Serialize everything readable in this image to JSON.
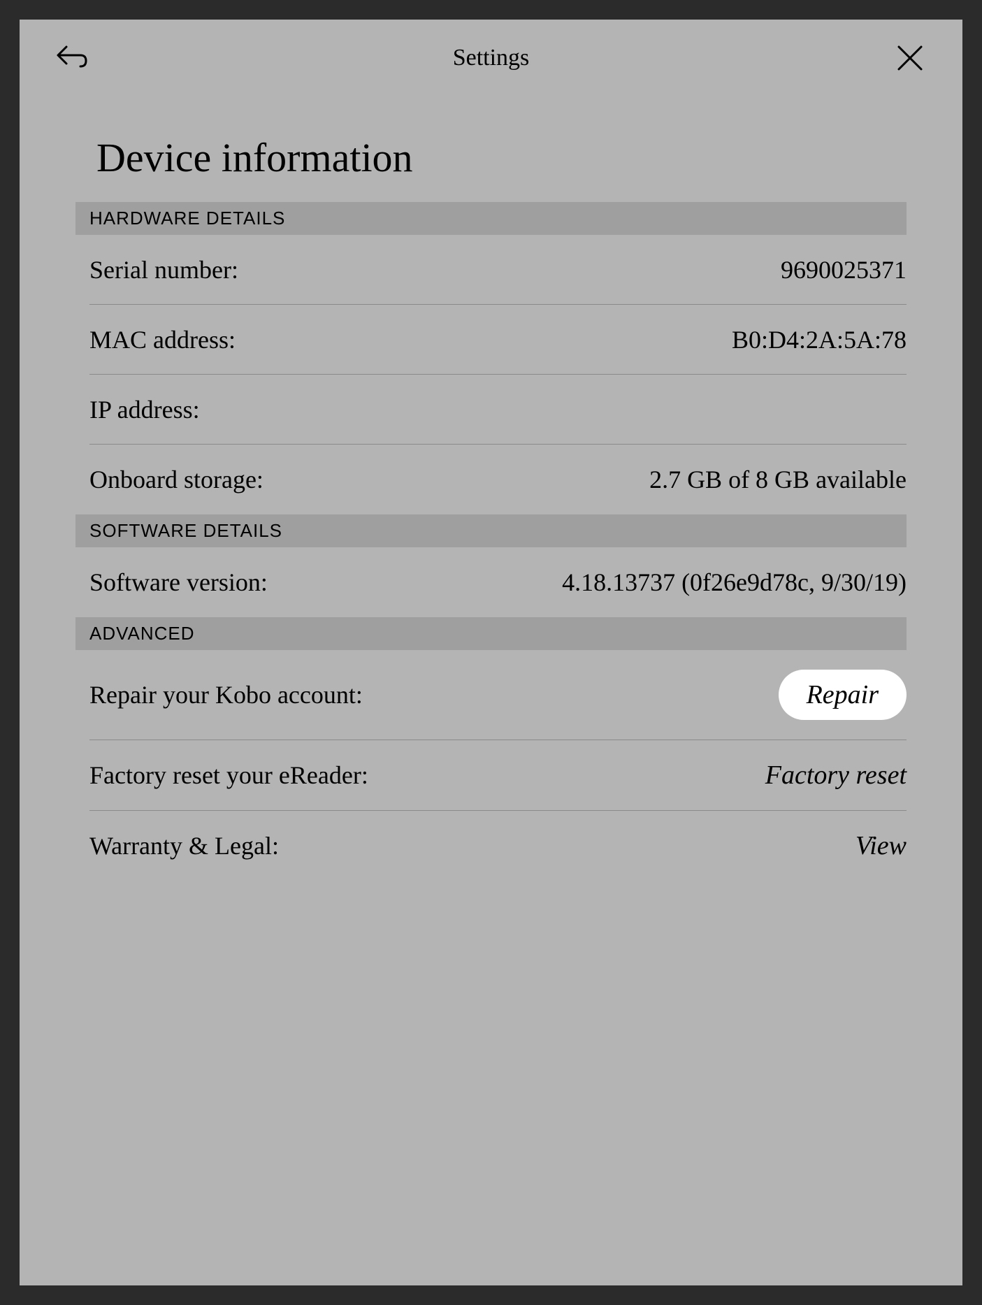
{
  "header": {
    "title": "Settings"
  },
  "page": {
    "title": "Device information"
  },
  "sections": {
    "hardware": {
      "header": "HARDWARE DETAILS",
      "serial_label": "Serial number:",
      "serial_value": "9690025371",
      "mac_label": "MAC address:",
      "mac_value": "B0:D4:2A:5A:78",
      "ip_label": "IP address:",
      "ip_value": "",
      "storage_label": "Onboard storage:",
      "storage_value": "2.7 GB of 8 GB available"
    },
    "software": {
      "header": "SOFTWARE DETAILS",
      "version_label": "Software version:",
      "version_value": "4.18.13737 (0f26e9d78c, 9/30/19)"
    },
    "advanced": {
      "header": "ADVANCED",
      "repair_label": "Repair your Kobo account:",
      "repair_action": "Repair",
      "reset_label": "Factory reset your eReader:",
      "reset_action": "Factory reset",
      "warranty_label": "Warranty & Legal:",
      "warranty_action": "View"
    }
  }
}
